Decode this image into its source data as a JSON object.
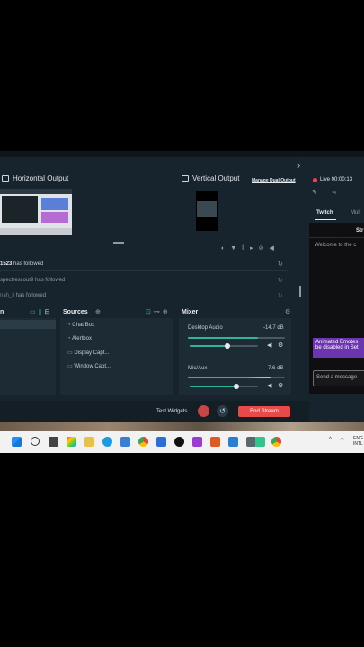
{
  "outputs": {
    "horizontal": "Horizontal Output",
    "vertical": "Vertical Output",
    "manage_dual": "Manage Dual Output"
  },
  "live": {
    "label": "Live 00:00:13"
  },
  "chat_tabs": {
    "twitch": "Twitch",
    "multi": "Mult"
  },
  "chat": {
    "title_partial": "Str",
    "welcome": "Welcome to the c",
    "notice_line1": "Animated Emotes",
    "notice_line2": "be disabled in Set",
    "send_placeholder": "Send a message"
  },
  "events": [
    {
      "name": "1523",
      "action": "has followed"
    },
    {
      "name": "spectrescout9",
      "action": "has followed"
    },
    {
      "name": "nah_ii",
      "action": "has followed"
    }
  ],
  "scenes": {
    "header": "n"
  },
  "sources": {
    "header": "Sources",
    "items": [
      "Chat Box",
      "Alertbox",
      "Display Capt...",
      "Window Capt..."
    ]
  },
  "mixer": {
    "header": "Mixer",
    "channels": [
      {
        "name": "Desktop Audio",
        "db": "-14.7 dB",
        "level": 0.55
      },
      {
        "name": "Mic/Aux",
        "db": "-7.6 dB",
        "level": 0.68
      }
    ]
  },
  "footer": {
    "test_widgets": "Test Widgets",
    "end_stream": "End Stream"
  },
  "taskbar": {
    "lang_line1": "ENG",
    "lang_line2": "INTL"
  },
  "colors": {
    "accent_green": "#2fb59c",
    "end_red": "#e84a4a",
    "live_red": "#ff4040",
    "twitch_purple": "#6b35b0"
  }
}
